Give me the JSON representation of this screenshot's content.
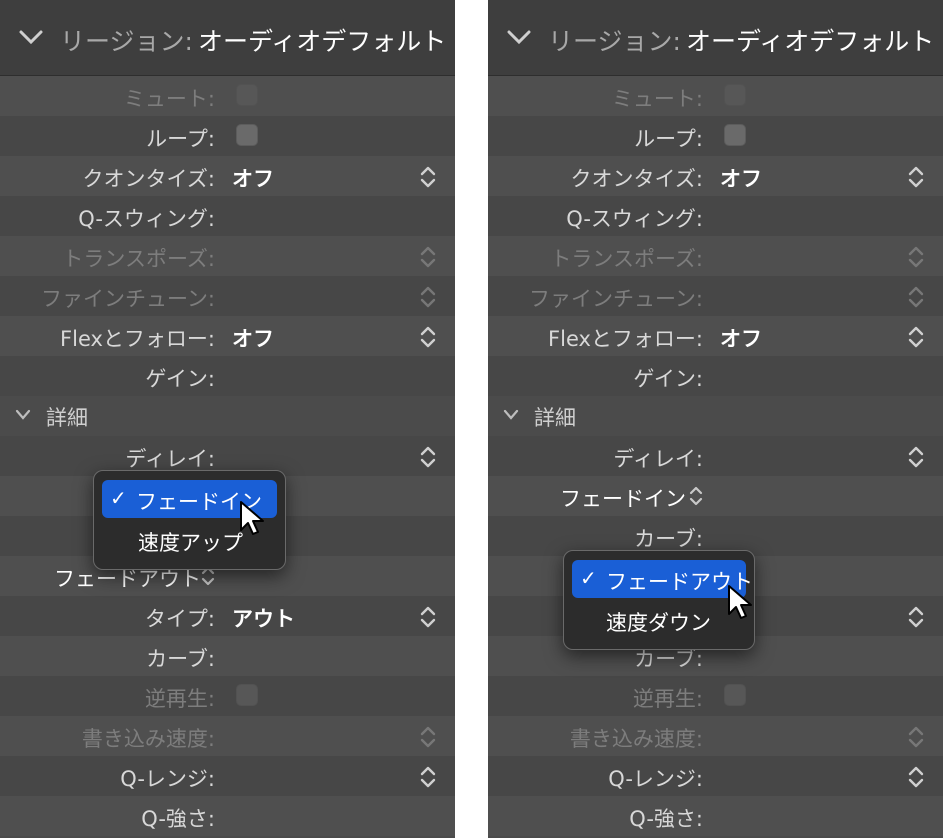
{
  "header": {
    "label": "リージョン:",
    "value": "オーディオデフォルト"
  },
  "rows": {
    "mute": "ミュート:",
    "loop": "ループ:",
    "quantize": "クオンタイズ:",
    "quantize_value": "オフ",
    "q_swing": "Q-スウィング:",
    "transpose": "トランスポーズ:",
    "fine_tune": "ファインチューン:",
    "flex_follow": "Flexとフォロー:",
    "flex_follow_value": "オフ",
    "gain": "ゲイン:",
    "details": "詳細",
    "delay": "ディレイ:",
    "fade_out_popup": "フェードアウト",
    "type": "タイプ:",
    "type_value": "アウト",
    "curve": "カーブ:",
    "reverse": "逆再生:",
    "write_speed": "書き込み速度:",
    "q_range": "Q-レンジ:",
    "q_strength": "Q-強さ:",
    "fade_in_popup": "フェードイン"
  },
  "left_menu": {
    "check": "✓",
    "items": [
      "フェードイン",
      "速度アップ"
    ],
    "selected": 0
  },
  "right_menu": {
    "check": "✓",
    "items": [
      "フェードアウト",
      "速度ダウン"
    ],
    "selected": 0
  },
  "colors": {
    "panel_bg": "#4b4b4b",
    "header_bg": "#3e3e3e",
    "menu_bg": "#2c2c2c",
    "selection": "#1a5fd6"
  },
  "icons": {
    "collapse": "chevron-down-icon",
    "stepper": "up-down-stepper-icon",
    "cursor": "arrow-pointer-icon"
  }
}
